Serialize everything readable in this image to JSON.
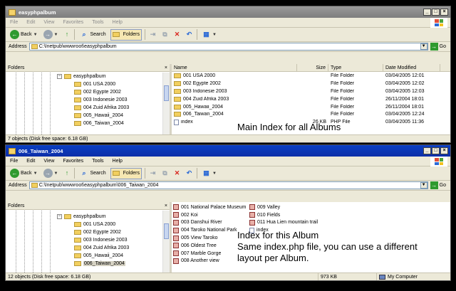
{
  "top_window": {
    "title": "easyphpalbum",
    "menu": [
      "File",
      "Edit",
      "View",
      "Favorites",
      "Tools",
      "Help"
    ],
    "toolbar": {
      "back": "Back",
      "search": "Search",
      "folders": "Folders"
    },
    "address": {
      "label": "Address",
      "value": "C:\\Inetpub\\wwwroot\\easyphpalbum",
      "go": "Go"
    },
    "tree": {
      "header": "Folders",
      "items": [
        "easyphpalbum",
        "001 USA 2000",
        "002 Egypte 2002",
        "003 Indonesie 2003",
        "004 Zuid Afrika 2003",
        "005_Hawaii_2004",
        "006_Taiwan_2004"
      ]
    },
    "columns": {
      "name": "Name",
      "size": "Size",
      "type": "Type",
      "date": "Date Modified"
    },
    "rows": [
      {
        "name": "001 USA 2000",
        "size": "",
        "type": "File Folder",
        "date": "03/04/2005 12:01",
        "kind": "folder"
      },
      {
        "name": "002 Egypte 2002",
        "size": "",
        "type": "File Folder",
        "date": "03/04/2005 12:02",
        "kind": "folder"
      },
      {
        "name": "003 Indonesie 2003",
        "size": "",
        "type": "File Folder",
        "date": "03/04/2005 12:03",
        "kind": "folder"
      },
      {
        "name": "004 Zuid Afrika 2003",
        "size": "",
        "type": "File Folder",
        "date": "26/11/2004 18:01",
        "kind": "folder"
      },
      {
        "name": "005_Hawaii_2004",
        "size": "",
        "type": "File Folder",
        "date": "26/11/2004 18:01",
        "kind": "folder"
      },
      {
        "name": "006_Taiwan_2004",
        "size": "",
        "type": "File Folder",
        "date": "03/04/2005 12:24",
        "kind": "folder"
      },
      {
        "name": "index",
        "size": "26 KB",
        "type": "PHP File",
        "date": "03/04/2005 11:36",
        "kind": "file"
      }
    ],
    "status": "7 objects (Disk free space: 6.18 GB)",
    "caption": "Main Index for all Albums"
  },
  "bottom_window": {
    "title": "006_Taiwan_2004",
    "menu": [
      "File",
      "Edit",
      "View",
      "Favorites",
      "Tools",
      "Help"
    ],
    "toolbar": {
      "back": "Back",
      "search": "Search",
      "folders": "Folders"
    },
    "address": {
      "label": "Address",
      "value": "C:\\Inetpub\\wwwroot\\easyphpalbum\\006_Taiwan_2004",
      "go": "Go"
    },
    "tree": {
      "header": "Folders",
      "items": [
        "easyphpalbum",
        "001 USA 2000",
        "002 Egypte 2002",
        "003 Indonesie 2003",
        "004 Zuid Afrika 2003",
        "005_Hawaii_2004",
        "006_Taiwan_2004"
      ]
    },
    "files": [
      {
        "name": "001 National Palace Museum",
        "kind": "image"
      },
      {
        "name": "002 Koi",
        "kind": "image"
      },
      {
        "name": "003 Danshui River",
        "kind": "image"
      },
      {
        "name": "004 Taroko National Park",
        "kind": "image"
      },
      {
        "name": "005 View Taroko",
        "kind": "image"
      },
      {
        "name": "006 Oldest Tree",
        "kind": "image"
      },
      {
        "name": "007 Marble Gorge",
        "kind": "image"
      },
      {
        "name": "008 Another view",
        "kind": "image"
      },
      {
        "name": "009 Valley",
        "kind": "image"
      },
      {
        "name": "010 Fields",
        "kind": "image"
      },
      {
        "name": "011 Hua Lien mountain trail",
        "kind": "image"
      },
      {
        "name": "index",
        "kind": "file"
      }
    ],
    "status": {
      "objects": "12 objects (Disk free space: 6.18 GB)",
      "size": "973 KB",
      "zone": "My Computer"
    },
    "caption": [
      "Index for this Album",
      "Same index.php file, you can use a different layout per Album."
    ]
  }
}
